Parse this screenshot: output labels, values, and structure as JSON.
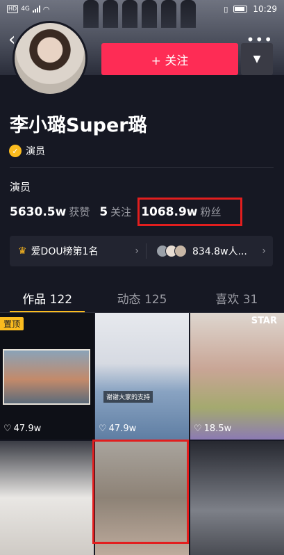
{
  "status_bar": {
    "network_badge": "HD",
    "network_type": "4G",
    "time": "10:29"
  },
  "header": {
    "back_icon": "back-arrow-icon",
    "more_icon": "more-dots-icon"
  },
  "profile": {
    "name": "李小璐Super璐",
    "verified_label": "演员",
    "bio": "演员",
    "follow_label": "+ 关注",
    "dropdown_icon": "triangle-down-icon"
  },
  "stats": {
    "likes": {
      "num": "5630.5w",
      "label": "获赞"
    },
    "following": {
      "num": "5",
      "label": "关注"
    },
    "fans": {
      "num": "1068.9w",
      "label": "粉丝"
    }
  },
  "rank_bar": {
    "rank_label": "爱DOU榜第1名",
    "fans_label": "834.8w人..."
  },
  "tabs": [
    {
      "label": "作品 122",
      "active": true
    },
    {
      "label": "动态 125",
      "active": false
    },
    {
      "label": "喜欢 31",
      "active": false
    }
  ],
  "grid": [
    {
      "pinned_label": "置顶",
      "likes": "47.9w"
    },
    {
      "caption": "谢谢大家的支持",
      "likes": "47.9w"
    },
    {
      "overlay_text": "STAR",
      "likes": "18.5w"
    },
    {
      "likes": ""
    },
    {
      "likes": ""
    },
    {
      "likes": ""
    }
  ],
  "colors": {
    "background": "#161823",
    "accent_follow": "#fe2c55",
    "accent_yellow": "#fbbc1f",
    "highlight_box": "#e21e1e"
  }
}
